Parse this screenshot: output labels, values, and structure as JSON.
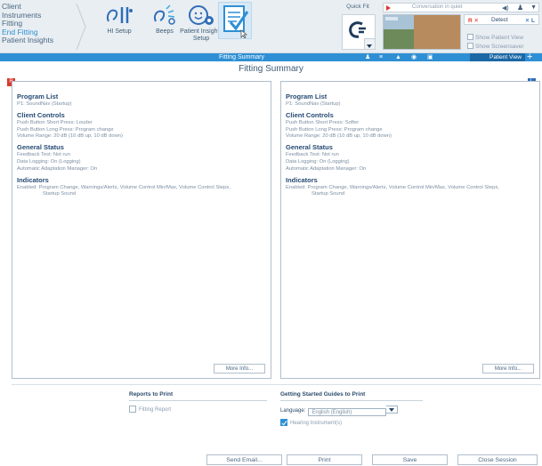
{
  "nav": {
    "items": [
      "Client",
      "Instruments",
      "Fitting",
      "End Fitting",
      "Patient Insights"
    ],
    "active_index": 3
  },
  "toolbar": {
    "hi_setup_label": "HI Setup",
    "beeps_label": "Beeps",
    "patient_insights_label": "Patient Insights",
    "patient_insights_label2": "Setup"
  },
  "quick_fit": {
    "label": "Quick Fit"
  },
  "environment": {
    "text": "Conversation in quiet"
  },
  "detect": {
    "r_label": "R ✕",
    "center_label": "Detect",
    "l_label": "✕ L"
  },
  "options": {
    "show_patient_view": "Show Patient View",
    "show_screensaver": "Show Screensaver"
  },
  "bluebar": {
    "title": "Fitting Summary",
    "patient_view_label": "Patient View",
    "plus": "+"
  },
  "page": {
    "title": "Fitting Summary"
  },
  "colors": {
    "accent": "#2e8fd4",
    "right_ear": "#d93a30",
    "left_ear": "#2f6db8"
  },
  "left_panel": {
    "badge": "R",
    "program_list_heading": "Program List",
    "program_list_line": "P1: SoundNav (Startup)",
    "client_controls_heading": "Client Controls",
    "cc_line1": "Push Button Short Press: Louder",
    "cc_line2": "Push Button Long Press: Program change",
    "cc_line3": "Volume Range: 20 dB (10 dB up, 10 dB down)",
    "general_status_heading": "General Status",
    "gs_line1": "Feedback Test: Not run",
    "gs_line2": "Data Logging: On (Logging)",
    "gs_line3": "Automatic Adaptation Manager: On",
    "indicators_heading": "Indicators",
    "ind_line1": "Enabled: Program Change, Warnings/Alerts, Volume Control Min/Max, Volume Control Steps,",
    "ind_line2": "Startup Sound",
    "more_info": "More Info..."
  },
  "right_panel": {
    "badge": "L",
    "program_list_heading": "Program List",
    "program_list_line": "P1: SoundNav (Startup)",
    "client_controls_heading": "Client Controls",
    "cc_line1": "Push Button Short Press: Softer",
    "cc_line2": "Push Button Long Press: Program change",
    "cc_line3": "Volume Range: 20 dB (10 dB up, 10 dB down)",
    "general_status_heading": "General Status",
    "gs_line1": "Feedback Test: Not run",
    "gs_line2": "Data Logging: On (Logging)",
    "gs_line3": "Automatic Adaptation Manager: On",
    "indicators_heading": "Indicators",
    "ind_line1": "Enabled: Program Change, Warnings/Alerts, Volume Control Min/Max, Volume Control Steps,",
    "ind_line2": "Startup Sound",
    "more_info": "More Info..."
  },
  "print": {
    "reports_heading": "Reports to Print",
    "fitting_report": "Fitting Report",
    "guides_heading": "Getting Started Guides to Print",
    "language_label": "Language:",
    "language_value": "English (English)",
    "hearing_instruments": "Hearing Instrument(s)",
    "hearing_instruments_checked": true,
    "fitting_report_checked": false
  },
  "actions": {
    "send_email": "Send Email...",
    "print": "Print",
    "save": "Save",
    "close_session": "Close Session"
  }
}
